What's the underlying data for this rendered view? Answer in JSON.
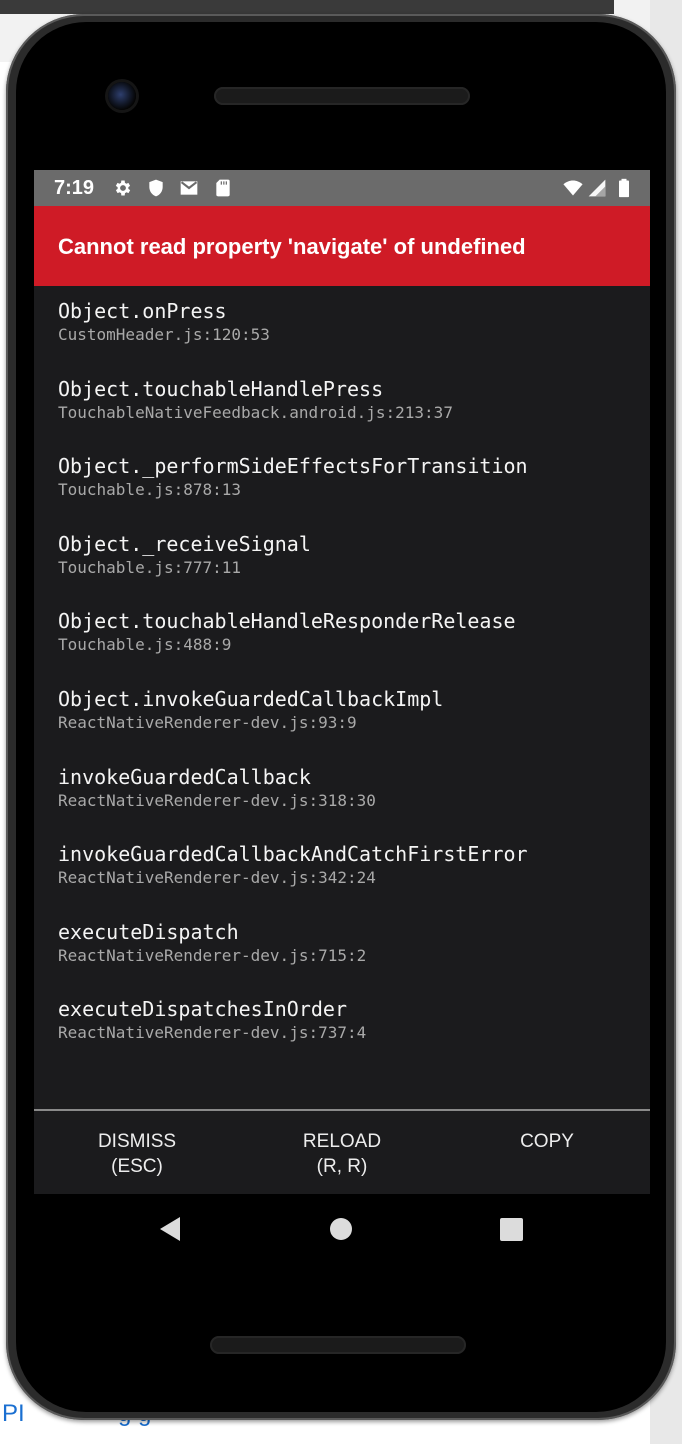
{
  "background": {
    "bottom_text": "PI",
    "bottom_text_2": "g g"
  },
  "status_bar": {
    "time": "7:19"
  },
  "error": {
    "title": "Cannot read property 'navigate' of undefined"
  },
  "stack_frames": [
    {
      "fn": "Object.onPress",
      "loc": "CustomHeader.js:120:53"
    },
    {
      "fn": "Object.touchableHandlePress",
      "loc": "TouchableNativeFeedback.android.js:213:37"
    },
    {
      "fn": "Object._performSideEffectsForTransition",
      "loc": "Touchable.js:878:13"
    },
    {
      "fn": "Object._receiveSignal",
      "loc": "Touchable.js:777:11"
    },
    {
      "fn": "Object.touchableHandleResponderRelease",
      "loc": "Touchable.js:488:9"
    },
    {
      "fn": "Object.invokeGuardedCallbackImpl",
      "loc": "ReactNativeRenderer-dev.js:93:9"
    },
    {
      "fn": "invokeGuardedCallback",
      "loc": "ReactNativeRenderer-dev.js:318:30"
    },
    {
      "fn": "invokeGuardedCallbackAndCatchFirstError",
      "loc": "ReactNativeRenderer-dev.js:342:24"
    },
    {
      "fn": "executeDispatch",
      "loc": "ReactNativeRenderer-dev.js:715:2"
    },
    {
      "fn": "executeDispatchesInOrder",
      "loc": "ReactNativeRenderer-dev.js:737:4"
    }
  ],
  "buttons": {
    "dismiss": {
      "line1": "DISMISS",
      "line2": "(ESC)"
    },
    "reload": {
      "line1": "RELOAD",
      "line2": "(R, R)"
    },
    "copy": {
      "line1": "COPY"
    }
  },
  "colors": {
    "error_header": "#cf1b26",
    "screen_bg": "#1b1b1d",
    "status_bar": "#6b6b6b"
  },
  "icons": [
    "settings-icon",
    "shield-icon",
    "gmail-icon",
    "sd-card-icon",
    "wifi-icon",
    "signal-icon",
    "battery-icon",
    "nav-back-icon",
    "nav-home-icon",
    "nav-recents-icon"
  ]
}
